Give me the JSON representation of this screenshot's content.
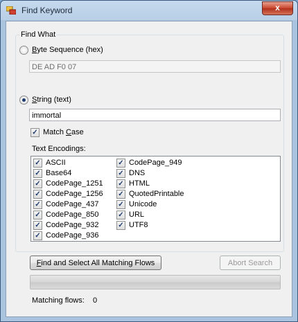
{
  "window": {
    "title": "Find Keyword",
    "close_glyph": "x"
  },
  "find_what": {
    "group_label": "Find What",
    "byte_sequence": {
      "label_accel": "B",
      "label_rest": "yte Sequence (hex)",
      "value": "DE AD F0 07",
      "selected": false
    },
    "string": {
      "label_accel": "S",
      "label_rest": "tring (text)",
      "value": "immortal",
      "selected": true
    },
    "match_case": {
      "label_pre": "Match ",
      "label_accel": "C",
      "label_rest": "ase",
      "checked": true
    },
    "encodings_label": "Text Encodings:",
    "encodings_col1": [
      "ASCII",
      "Base64",
      "CodePage_1251",
      "CodePage_1256",
      "CodePage_437",
      "CodePage_850",
      "CodePage_932",
      "CodePage_936"
    ],
    "encodings_col2": [
      "CodePage_949",
      "DNS",
      "HTML",
      "QuotedPrintable",
      "Unicode",
      "URL",
      "UTF8"
    ]
  },
  "actions": {
    "find_button_accel": "F",
    "find_button_rest": "ind and Select All Matching Flows",
    "abort_button": "Abort Search"
  },
  "progress": {
    "value": 0
  },
  "status": {
    "matching_label": "Matching flows:",
    "matching_count": "0"
  }
}
